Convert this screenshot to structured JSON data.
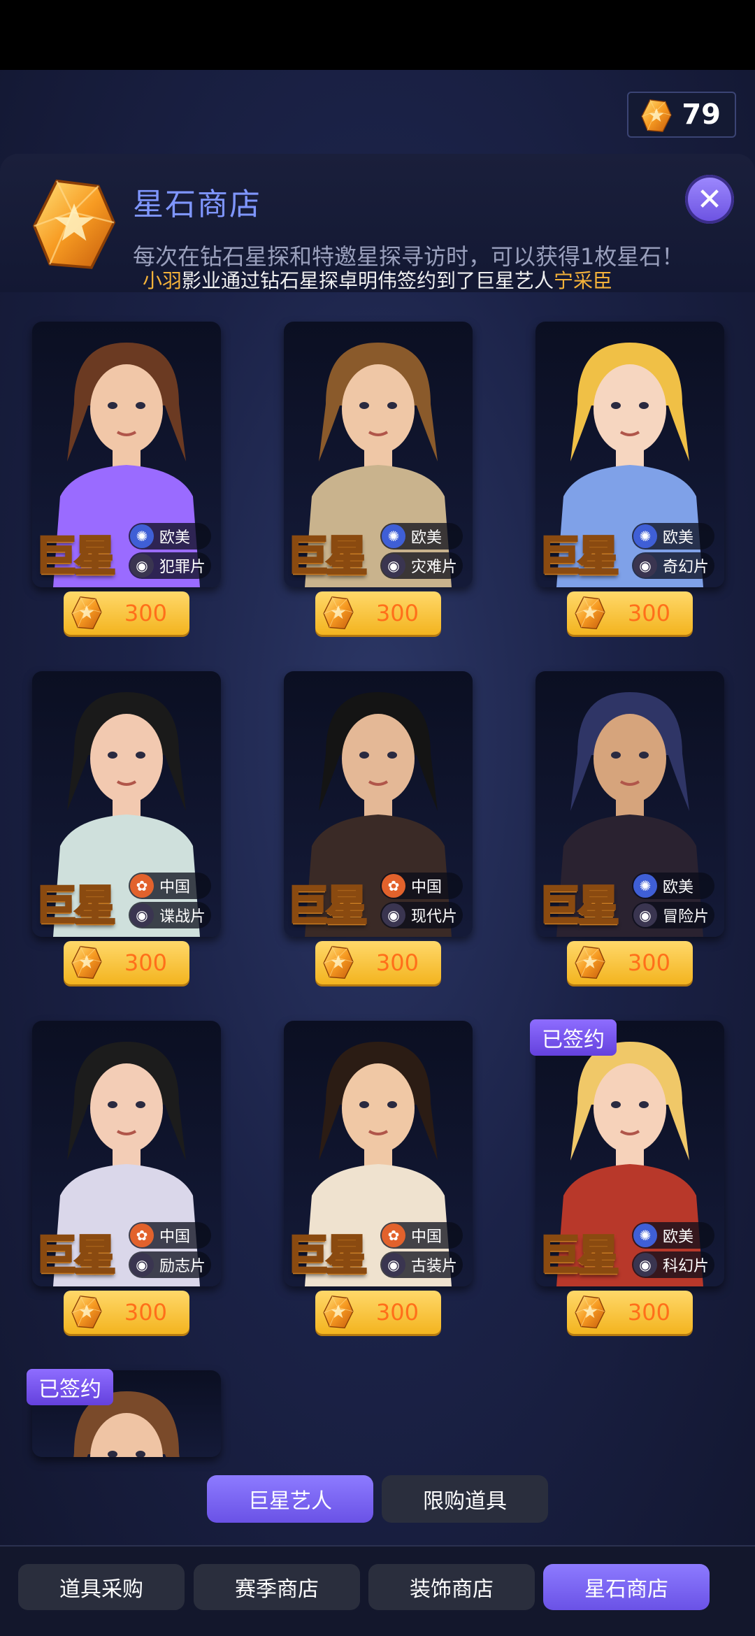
{
  "currency": {
    "amount": "79",
    "icon": "star-stone-icon"
  },
  "banner": {
    "title": "星石商店",
    "description": "每次在钻石星探和特邀星探寻访时，可以获得1枚星石！",
    "close_icon": "close-icon"
  },
  "notice": {
    "studio": "小羽",
    "middle": "影业通过钻石星探卓明伟签约到了巨星艺人",
    "artist": "宁采臣"
  },
  "rank_label": "巨星",
  "signed_label": "已签约",
  "cards": [
    {
      "region": "欧美",
      "genre": "犯罪片",
      "price": "300",
      "signed": false,
      "hair": "#6b3a22",
      "shirt": "#9a6bff",
      "skin": "#f1c7a8"
    },
    {
      "region": "欧美",
      "genre": "灾难片",
      "price": "300",
      "signed": false,
      "hair": "#8a5a2b",
      "shirt": "#c9b38d",
      "skin": "#efc7a6"
    },
    {
      "region": "欧美",
      "genre": "奇幻片",
      "price": "300",
      "signed": false,
      "hair": "#f0c046",
      "shirt": "#7fa1e8",
      "skin": "#f6d6c0"
    },
    {
      "region": "中国",
      "genre": "谍战片",
      "price": "300",
      "signed": false,
      "hair": "#1a1a1a",
      "shirt": "#cfe0dc",
      "skin": "#f2c9b0"
    },
    {
      "region": "中国",
      "genre": "现代片",
      "price": "300",
      "signed": false,
      "hair": "#141414",
      "shirt": "#3a2a26",
      "skin": "#e4b896"
    },
    {
      "region": "欧美",
      "genre": "冒险片",
      "price": "300",
      "signed": false,
      "hair": "#2f3566",
      "shirt": "#2a2230",
      "skin": "#d6a47c"
    },
    {
      "region": "中国",
      "genre": "励志片",
      "price": "300",
      "signed": false,
      "hair": "#1c1c1c",
      "shirt": "#dad7ea",
      "skin": "#f3cdb6"
    },
    {
      "region": "中国",
      "genre": "古装片",
      "price": "300",
      "signed": false,
      "hair": "#2b1c14",
      "shirt": "#efe2cf",
      "skin": "#f0c8a5"
    },
    {
      "region": "欧美",
      "genre": "科幻片",
      "price": "300",
      "signed": true,
      "hair": "#f0c868",
      "shirt": "#b8382a",
      "skin": "#f6d2ba"
    },
    {
      "signed": true,
      "hair": "#7a4a2a",
      "shirt": "#394060",
      "skin": "#efc4a4"
    }
  ],
  "subtabs": [
    {
      "label": "巨星艺人",
      "active": true
    },
    {
      "label": "限购道具",
      "active": false
    }
  ],
  "bottom_nav": [
    {
      "label": "道具采购",
      "active": false
    },
    {
      "label": "赛季商店",
      "active": false
    },
    {
      "label": "装饰商店",
      "active": false
    },
    {
      "label": "星石商店",
      "active": true
    }
  ],
  "colors": {
    "accent": "#7a63ee",
    "gold": "#f3b41f",
    "price_text": "#ff6f1a",
    "highlight": "#f4b23a"
  }
}
